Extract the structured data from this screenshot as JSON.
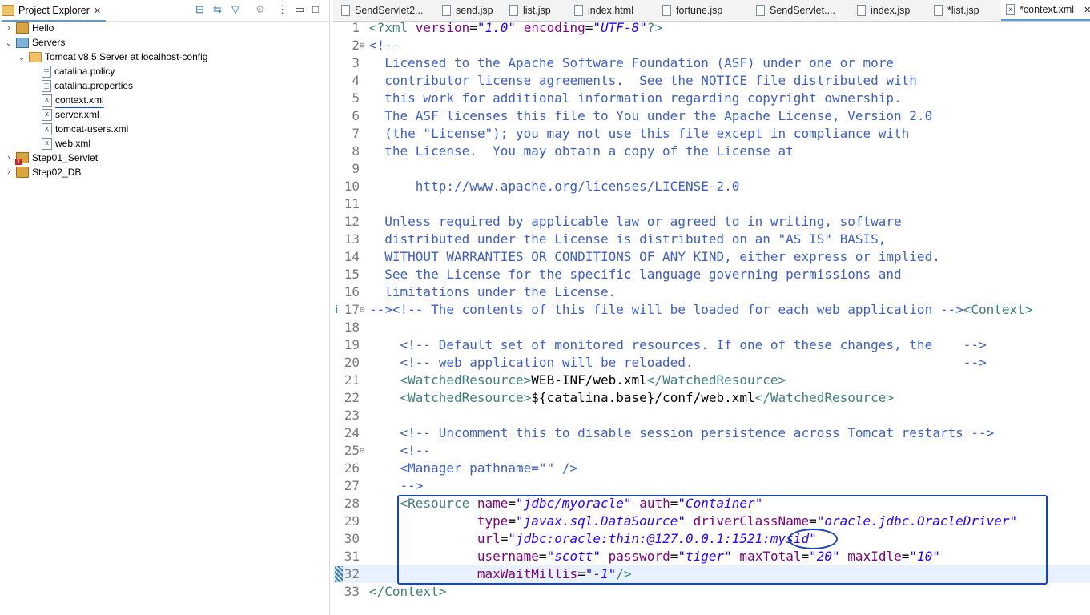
{
  "left_panel": {
    "tab_title": "Project Explorer",
    "tab_close": "✕",
    "toolbar": [
      "collapse-all-icon",
      "link-editor-icon",
      "filter-icon",
      "sync-icon",
      "view-menu-icon",
      "minimize-icon",
      "maximize-icon"
    ],
    "tree": [
      {
        "label": "Hello",
        "level": 0,
        "expanded": false,
        "icon": "project-icon"
      },
      {
        "label": "Servers",
        "level": 0,
        "expanded": true,
        "icon": "servers-project-icon"
      },
      {
        "label": "Tomcat v8.5 Server at localhost-config",
        "level": 1,
        "expanded": true,
        "icon": "folder-icon"
      },
      {
        "label": "catalina.policy",
        "level": 2,
        "icon": "file-icon"
      },
      {
        "label": "catalina.properties",
        "level": 2,
        "icon": "file-icon"
      },
      {
        "label": "context.xml",
        "level": 2,
        "icon": "xml-file-icon",
        "selected": true
      },
      {
        "label": "server.xml",
        "level": 2,
        "icon": "xml-file-icon"
      },
      {
        "label": "tomcat-users.xml",
        "level": 2,
        "icon": "xml-file-icon"
      },
      {
        "label": "web.xml",
        "level": 2,
        "icon": "xml-file-icon"
      },
      {
        "label": "Step01_Servlet",
        "level": 0,
        "expanded": false,
        "icon": "error-project-icon"
      },
      {
        "label": "Step02_DB",
        "level": 0,
        "expanded": false,
        "icon": "project-icon"
      }
    ]
  },
  "editor": {
    "tabs": [
      {
        "label": "SendServlet2..."
      },
      {
        "label": "send.jsp"
      },
      {
        "label": "list.jsp"
      },
      {
        "label": "index.html"
      },
      {
        "label": "fortune.jsp"
      },
      {
        "label": "SendServlet...."
      },
      {
        "label": "index.jsp"
      },
      {
        "label": "*list.jsp"
      },
      {
        "label": "*context.xml",
        "active": true,
        "close": "✕"
      }
    ],
    "lines": [
      {
        "n": "1",
        "segs": [
          [
            "t",
            "<?"
          ],
          [
            "t",
            "xml "
          ],
          [
            "a",
            "version"
          ],
          [
            "",
            "="
          ],
          [
            "v",
            "\"1.0\""
          ],
          [
            "",
            " "
          ],
          [
            "a",
            "encoding"
          ],
          [
            "",
            "="
          ],
          [
            "v",
            "\"UTF-8\""
          ],
          [
            "t",
            "?>"
          ]
        ]
      },
      {
        "n": "2",
        "fold": "⊖",
        "segs": [
          [
            "c",
            "<!--"
          ]
        ]
      },
      {
        "n": "3",
        "segs": [
          [
            "c",
            "  Licensed to the Apache Software Foundation (ASF) under one or more"
          ]
        ]
      },
      {
        "n": "4",
        "segs": [
          [
            "c",
            "  contributor license agreements.  See the NOTICE file distributed with"
          ]
        ]
      },
      {
        "n": "5",
        "segs": [
          [
            "c",
            "  this work for additional information regarding copyright ownership."
          ]
        ]
      },
      {
        "n": "6",
        "segs": [
          [
            "c",
            "  The ASF licenses this file to You under the Apache License, Version 2.0"
          ]
        ]
      },
      {
        "n": "7",
        "segs": [
          [
            "c",
            "  (the \"License\"); you may not use this file except in compliance with"
          ]
        ]
      },
      {
        "n": "8",
        "segs": [
          [
            "c",
            "  the License.  You may obtain a copy of the License at"
          ]
        ]
      },
      {
        "n": "9",
        "segs": [
          [
            "c",
            ""
          ]
        ]
      },
      {
        "n": "10",
        "segs": [
          [
            "c",
            "      http://www.apache.org/licenses/LICENSE-2.0"
          ]
        ]
      },
      {
        "n": "11",
        "segs": [
          [
            "c",
            ""
          ]
        ]
      },
      {
        "n": "12",
        "segs": [
          [
            "c",
            "  Unless required by applicable law or agreed to in writing, software"
          ]
        ]
      },
      {
        "n": "13",
        "segs": [
          [
            "c",
            "  distributed under the License is distributed on an \"AS IS\" BASIS,"
          ]
        ]
      },
      {
        "n": "14",
        "segs": [
          [
            "c",
            "  WITHOUT WARRANTIES OR CONDITIONS OF ANY KIND, either express or implied."
          ]
        ]
      },
      {
        "n": "15",
        "segs": [
          [
            "c",
            "  See the License for the specific language governing permissions and"
          ]
        ]
      },
      {
        "n": "16",
        "segs": [
          [
            "c",
            "  limitations under the License."
          ]
        ]
      },
      {
        "n": "17",
        "fold": "⊖",
        "segs": [
          [
            "c",
            "--><!-- The contents of this file will be loaded for each web application -->"
          ],
          [
            "t",
            "<Context>"
          ]
        ]
      },
      {
        "n": "18",
        "segs": [
          [
            "",
            ""
          ]
        ]
      },
      {
        "n": "19",
        "segs": [
          [
            "c",
            "    <!-- Default set of monitored resources. If one of these changes, the    -->"
          ]
        ]
      },
      {
        "n": "20",
        "segs": [
          [
            "c",
            "    <!-- web application will be reloaded.                                   -->"
          ]
        ]
      },
      {
        "n": "21",
        "segs": [
          [
            "",
            " "
          ],
          [
            "t",
            "   <WatchedResource>"
          ],
          [
            "",
            "WEB-INF/web.xml"
          ],
          [
            "t",
            "</WatchedResource>"
          ]
        ]
      },
      {
        "n": "22",
        "segs": [
          [
            "",
            " "
          ],
          [
            "t",
            "   <WatchedResource>"
          ],
          [
            "",
            "${catalina.base}/conf/web.xml"
          ],
          [
            "t",
            "</WatchedResource>"
          ]
        ]
      },
      {
        "n": "23",
        "segs": [
          [
            "",
            ""
          ]
        ]
      },
      {
        "n": "24",
        "segs": [
          [
            "c",
            "    <!-- Uncomment this to disable session persistence across Tomcat restarts -->"
          ]
        ]
      },
      {
        "n": "25",
        "fold": "⊖",
        "segs": [
          [
            "c",
            "    <!--"
          ]
        ]
      },
      {
        "n": "26",
        "segs": [
          [
            "c",
            "    <Manager pathname=\"\" />"
          ]
        ]
      },
      {
        "n": "27",
        "segs": [
          [
            "c",
            "    -->"
          ]
        ]
      },
      {
        "n": "28",
        "segs": [
          [
            "",
            " "
          ],
          [
            "t",
            "   <Resource "
          ],
          [
            "a",
            "name"
          ],
          [
            "",
            "="
          ],
          [
            "v",
            "\"jdbc/myoracle\""
          ],
          [
            "",
            " "
          ],
          [
            "a",
            "auth"
          ],
          [
            "",
            "="
          ],
          [
            "v",
            "\"Container\""
          ]
        ]
      },
      {
        "n": "29",
        "segs": [
          [
            "",
            "              "
          ],
          [
            "a",
            "type"
          ],
          [
            "",
            "="
          ],
          [
            "v",
            "\"javax.sql.DataSource\""
          ],
          [
            "",
            " "
          ],
          [
            "a",
            "driverClassName"
          ],
          [
            "",
            "="
          ],
          [
            "v",
            "\"oracle.jdbc.OracleDriver\""
          ]
        ]
      },
      {
        "n": "30",
        "segs": [
          [
            "",
            "              "
          ],
          [
            "a",
            "url"
          ],
          [
            "",
            "="
          ],
          [
            "v",
            "\"jdbc:oracle:thin:@127.0.0.1:1521:mysid\""
          ]
        ]
      },
      {
        "n": "31",
        "segs": [
          [
            "",
            "              "
          ],
          [
            "a",
            "username"
          ],
          [
            "",
            "="
          ],
          [
            "v",
            "\"scott\""
          ],
          [
            "",
            " "
          ],
          [
            "a",
            "password"
          ],
          [
            "",
            "="
          ],
          [
            "v",
            "\"tiger\""
          ],
          [
            "",
            " "
          ],
          [
            "a",
            "maxTotal"
          ],
          [
            "",
            "="
          ],
          [
            "v",
            "\"20\""
          ],
          [
            "",
            " "
          ],
          [
            "a",
            "maxIdle"
          ],
          [
            "",
            "="
          ],
          [
            "v",
            "\"10\""
          ]
        ]
      },
      {
        "n": "32",
        "hl": true,
        "segs": [
          [
            "",
            "              "
          ],
          [
            "a",
            "maxWaitMillis"
          ],
          [
            "",
            "="
          ],
          [
            "v",
            "\"-1\""
          ],
          [
            "t",
            "/>"
          ]
        ]
      },
      {
        "n": "33",
        "segs": [
          [
            "t",
            "</Context>"
          ]
        ]
      }
    ]
  }
}
